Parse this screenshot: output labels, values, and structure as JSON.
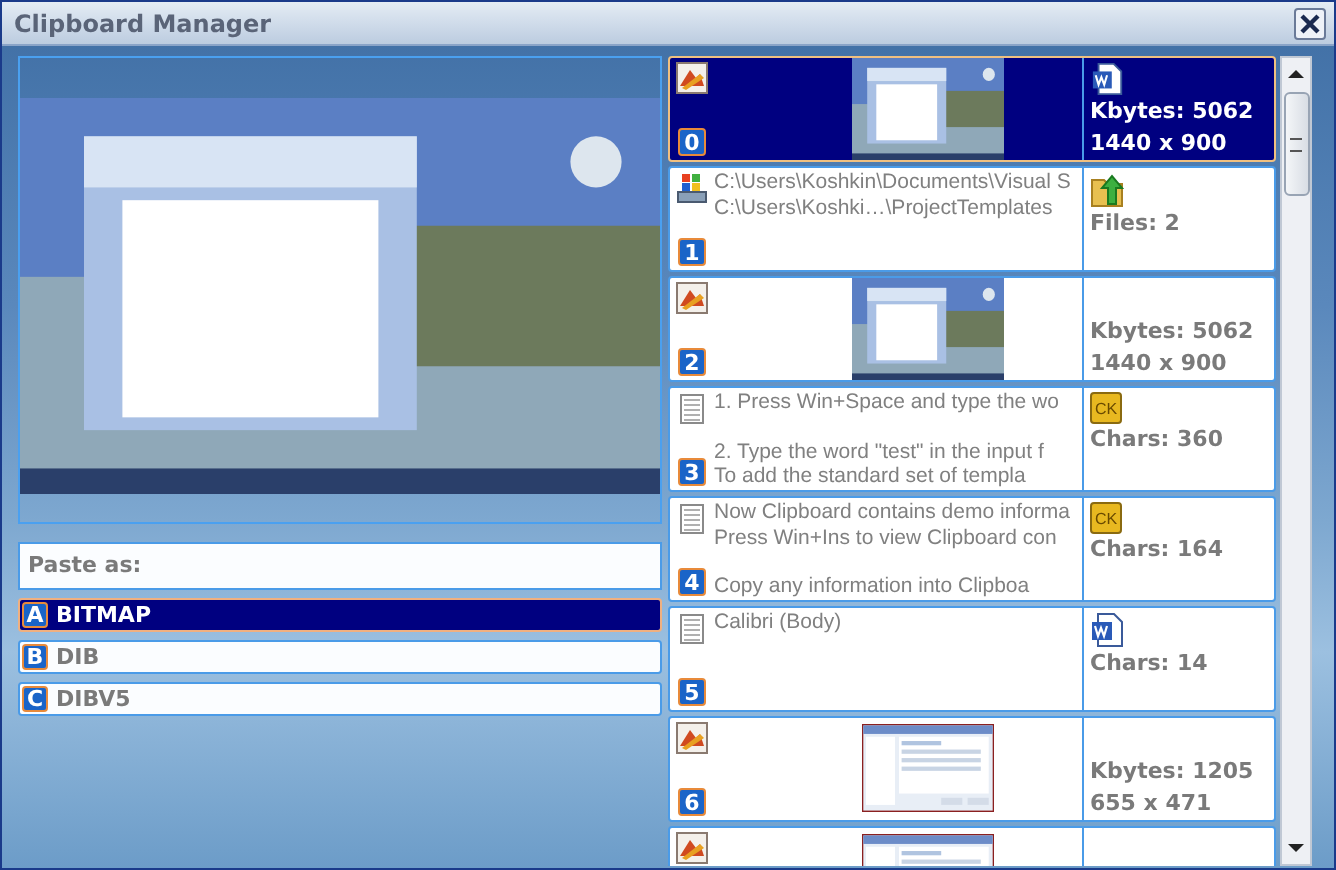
{
  "window": {
    "title": "Clipboard Manager"
  },
  "paste_as": {
    "label": "Paste as:",
    "formats": [
      {
        "key": "A",
        "name": "BITMAP",
        "selected": true
      },
      {
        "key": "B",
        "name": "DIB",
        "selected": false
      },
      {
        "key": "C",
        "name": "DIBV5",
        "selected": false
      }
    ]
  },
  "clips": [
    {
      "kind": "image",
      "index": "0",
      "selected": true,
      "thumbnail": {
        "kind": "desktop"
      },
      "format_icon": {
        "kind": "word"
      },
      "stats": [
        "Kbytes: 5062",
        "1440 x 900"
      ]
    },
    {
      "kind": "files",
      "index": "1",
      "selected": false,
      "paragraphs": [
        [
          "C:\\Users\\Koshkin\\Documents\\Visual S",
          "C:\\Users\\Koshki…\\ProjectTemplates"
        ]
      ],
      "format_icon": {
        "kind": "folder"
      },
      "stats": [
        "Files: 2"
      ]
    },
    {
      "kind": "image",
      "index": "2",
      "selected": false,
      "thumbnail": {
        "kind": "desktop"
      },
      "stats": [
        "Kbytes: 5062",
        "1440 x 900"
      ]
    },
    {
      "kind": "text",
      "index": "3",
      "selected": false,
      "paragraphs": [
        [
          "1. Press Win+Space and type the wo"
        ],
        [
          "2. Type the word \"test\" in the input f",
          "To add the standard set of templa"
        ]
      ],
      "format_icon": {
        "kind": "ck",
        "text": "CK"
      },
      "stats": [
        "Chars: 360"
      ]
    },
    {
      "kind": "text",
      "index": "4",
      "selected": false,
      "paragraphs": [
        [
          "Now Clipboard contains demo informa",
          "Press Win+Ins to view Clipboard con"
        ],
        [
          "Copy any information into Clipboa"
        ]
      ],
      "format_icon": {
        "kind": "ck",
        "text": "CK"
      },
      "stats": [
        "Chars: 164"
      ]
    },
    {
      "kind": "text",
      "index": "5",
      "selected": false,
      "paragraphs": [
        [
          "Calibri (Body)"
        ]
      ],
      "format_icon": {
        "kind": "word"
      },
      "stats": [
        "Chars: 14"
      ]
    },
    {
      "kind": "image",
      "index": "6",
      "selected": false,
      "thumbnail": {
        "kind": "window"
      },
      "stats": [
        "Kbytes: 1205",
        "655 x 471"
      ]
    },
    {
      "kind": "image",
      "selected": false,
      "thumbnail": {
        "kind": "window"
      }
    }
  ]
}
